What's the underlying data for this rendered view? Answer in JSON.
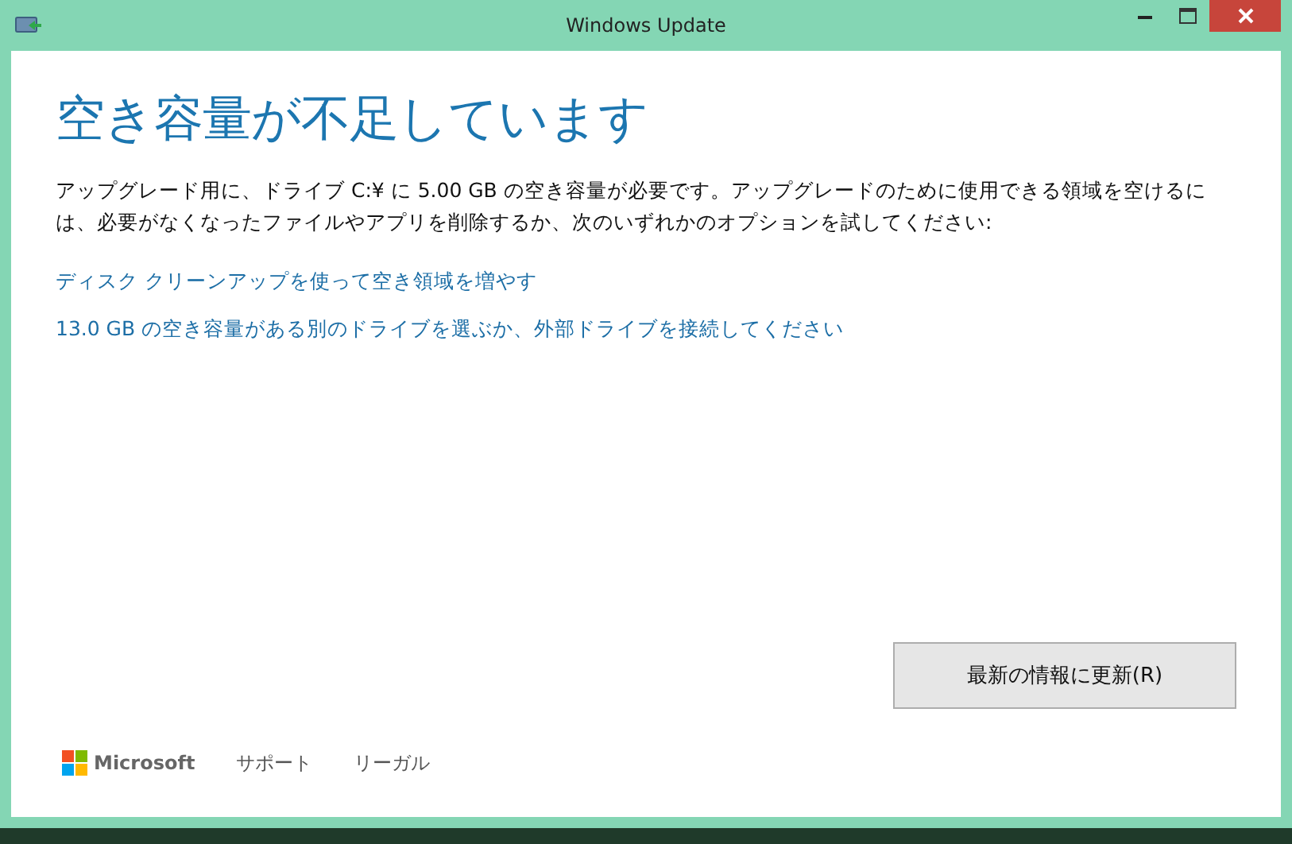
{
  "window": {
    "title": "Windows Update"
  },
  "heading": "空き容量が不足しています",
  "message": "アップグレード用に、ドライブ C:¥ に 5.00 GB の空き容量が必要です。アップグレードのために使用できる領域を空けるには、必要がなくなったファイルやアプリを削除するか、次のいずれかのオプションを試してください:",
  "options": [
    "ディスク クリーンアップを使って空き領域を増やす",
    "13.0 GB の空き容量がある別のドライブを選ぶか、外部ドライブを接続してください"
  ],
  "refresh_button": "最新の情報に更新(R)",
  "footer": {
    "brand": "Microsoft",
    "links": [
      "サポート",
      "リーガル"
    ]
  }
}
